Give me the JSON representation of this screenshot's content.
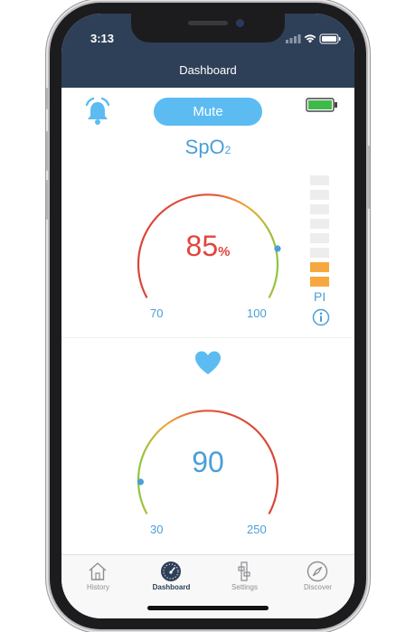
{
  "status_bar": {
    "time": "3:13"
  },
  "nav": {
    "title": "Dashboard"
  },
  "controls": {
    "mute_label": "Mute"
  },
  "spo2": {
    "label_main": "SpO",
    "label_sub": "2",
    "value": "85",
    "unit": "%",
    "range_min": "70",
    "range_max": "100",
    "marker_value": 95,
    "value_color": "#e2453c"
  },
  "perfusion_index": {
    "label": "PI",
    "total_bars": 8,
    "active_bars": 2,
    "active_color": "#f5a840"
  },
  "pulse": {
    "value": "90",
    "range_min": "30",
    "range_max": "250",
    "marker_value": 55,
    "value_color": "#4a9fd6"
  },
  "tabs": [
    {
      "label": "History",
      "icon": "house-icon",
      "active": false
    },
    {
      "label": "Dashboard",
      "icon": "gauge-icon",
      "active": true
    },
    {
      "label": "Settings",
      "icon": "sliders-icon",
      "active": false
    },
    {
      "label": "Discover",
      "icon": "compass-icon",
      "active": false
    }
  ],
  "colors": {
    "accent": "#5cbcf2",
    "header": "#2e4057",
    "label_blue": "#4a9fd6",
    "arc_red": "#d9453a",
    "arc_orange": "#f0a83c",
    "arc_green": "#8cc63e",
    "battery_green": "#3fba4a"
  }
}
